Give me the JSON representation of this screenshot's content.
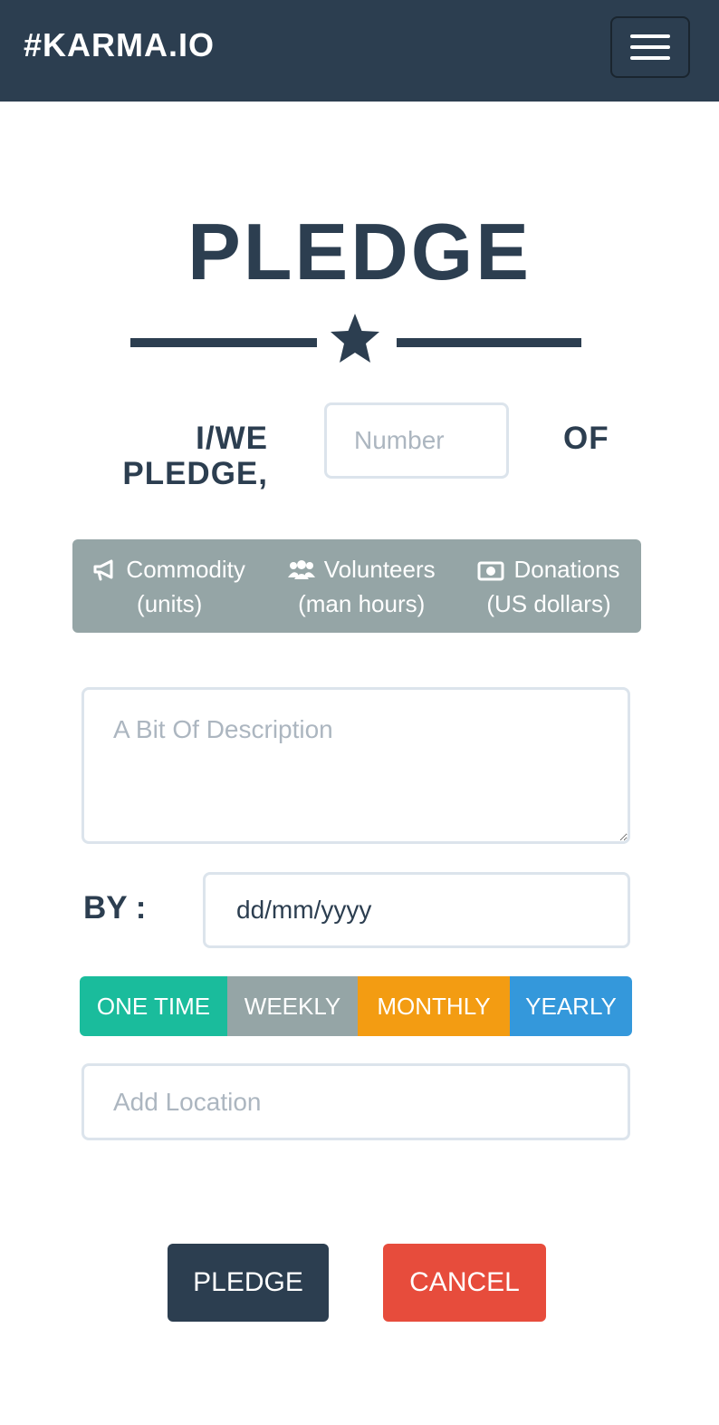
{
  "navbar": {
    "brand": "#KARMA.IO",
    "menu_icon": "hamburger-menu-icon"
  },
  "page": {
    "title": "PLEDGE",
    "divider_icon": "star-icon"
  },
  "pledge_row": {
    "label": "I/WE PLEDGE,",
    "number_placeholder": "Number",
    "of_label": "OF"
  },
  "type_options": [
    {
      "icon": "bullhorn-icon",
      "label": "Commodity",
      "unit": "(units)"
    },
    {
      "icon": "users-icon",
      "label": "Volunteers",
      "unit": "(man hours)"
    },
    {
      "icon": "money-icon",
      "label": "Donations",
      "unit": "(US dollars)"
    }
  ],
  "description": {
    "placeholder": "A Bit Of Description"
  },
  "by": {
    "label": "BY :",
    "date_placeholder": "dd/mm/yyyy"
  },
  "frequency": [
    {
      "label": "ONE TIME",
      "color": "#1abc9c"
    },
    {
      "label": "WEEKLY",
      "color": "#95a5a6"
    },
    {
      "label": "MONTHLY",
      "color": "#f39c12"
    },
    {
      "label": "YEARLY",
      "color": "#3498db"
    }
  ],
  "location": {
    "placeholder": "Add Location"
  },
  "actions": {
    "pledge_label": "PLEDGE",
    "cancel_label": "CANCEL"
  },
  "colors": {
    "primary": "#2c3e50",
    "danger": "#e74c3c",
    "muted": "#95a5a6",
    "input_border": "#dce4ec"
  }
}
